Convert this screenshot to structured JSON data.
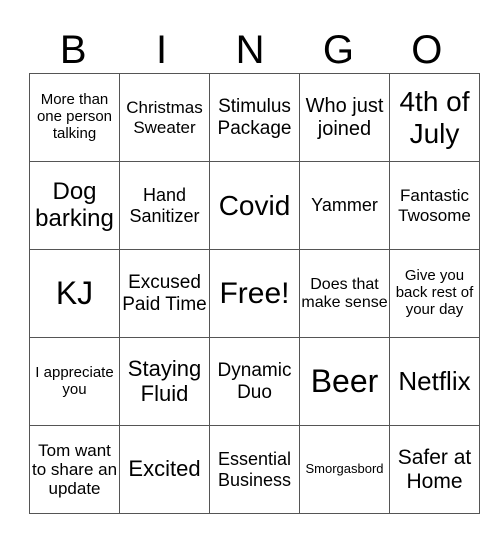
{
  "header": {
    "letters": [
      "B",
      "I",
      "N",
      "G",
      "O"
    ]
  },
  "rows": [
    [
      "More than one person talking",
      "Christmas Sweater",
      "Stimulus Package",
      "Who just joined",
      "4th of July"
    ],
    [
      "Dog barking",
      "Hand Sanitizer",
      "Covid",
      "Yammer",
      "Fantastic Twosome"
    ],
    [
      "KJ",
      "Excused Paid Time",
      "Free!",
      "Does that make sense",
      "Give you back rest of your day"
    ],
    [
      "I appreciate you",
      "Staying Fluid",
      "Dynamic Duo",
      "Beer",
      "Netflix"
    ],
    [
      "Tom want to share an update",
      "Excited",
      "Essential Business",
      "Smorgasbord",
      "Safer at Home"
    ]
  ]
}
